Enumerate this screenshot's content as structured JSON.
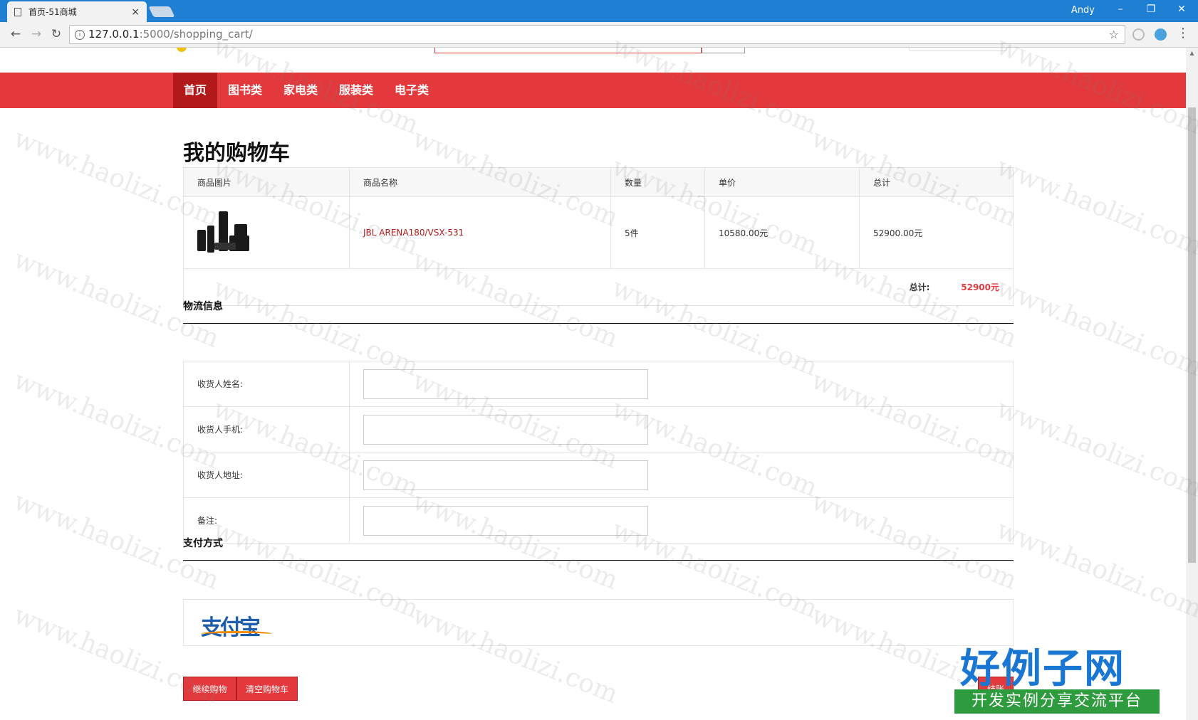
{
  "browser": {
    "tab_title": "首页-51商城",
    "tab_close": "×",
    "user": "Andy",
    "url_host": "127.0.0.1",
    "url_path": ":5000/shopping_cart/",
    "win_min": "–",
    "win_restore": "❐",
    "win_close": "✕",
    "back": "←",
    "forward": "→",
    "reload": "↻",
    "star": "☆",
    "menu": "⋮",
    "info": "i"
  },
  "nav": {
    "items": [
      {
        "label": "首页",
        "active": true
      },
      {
        "label": "图书类",
        "active": false
      },
      {
        "label": "家电类",
        "active": false
      },
      {
        "label": "服装类",
        "active": false
      },
      {
        "label": "电子类",
        "active": false
      }
    ]
  },
  "cart": {
    "title": "我的购物车",
    "columns": [
      "商品图片",
      "商品名称",
      "数量",
      "单价",
      "总计"
    ],
    "rows": [
      {
        "name": "JBL ARENA180/VSX-531",
        "quantity": "5件",
        "unit_price": "10580.00元",
        "subtotal": "52900.00元"
      }
    ],
    "total_label": "总计:",
    "total_value": "52900元"
  },
  "shipping": {
    "title": "物流信息",
    "fields": [
      {
        "label": "收货人姓名:",
        "value": ""
      },
      {
        "label": "收货人手机:",
        "value": ""
      },
      {
        "label": "收货人地址:",
        "value": ""
      },
      {
        "label": "备注:",
        "value": ""
      }
    ]
  },
  "payment": {
    "title": "支付方式",
    "alipay_logo_text": "支付宝"
  },
  "actions": {
    "continue": "继续购物",
    "clear": "清空购物车",
    "checkout": "结账"
  },
  "watermark": {
    "text": "www.haolizi.com",
    "brand_big": "好例子网",
    "brand_small": "开发实例分享交流平台"
  },
  "colors": {
    "accent": "#e4393c",
    "accent_dark": "#b1191a",
    "chrome_blue": "#1f7fd3"
  }
}
